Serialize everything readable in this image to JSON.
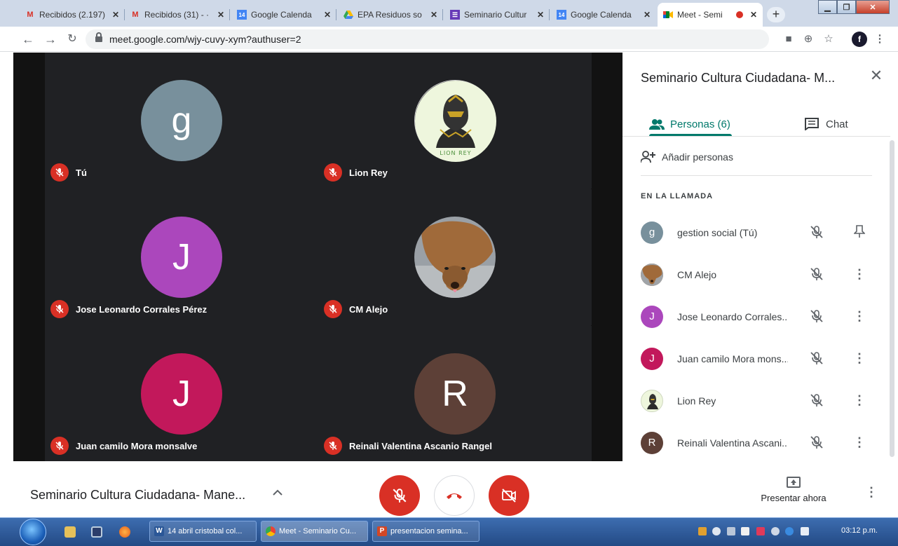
{
  "browser": {
    "tabs": [
      {
        "title": "Recibidos (2.197)",
        "favicon": "gmail-icon"
      },
      {
        "title": "Recibidos (31) - ·",
        "favicon": "gmail-icon"
      },
      {
        "title": "Google Calenda",
        "favicon": "calendar-icon"
      },
      {
        "title": "EPA Residuos so",
        "favicon": "drive-icon"
      },
      {
        "title": "Seminario Cultur",
        "favicon": "forms-icon"
      },
      {
        "title": "Google Calenda",
        "favicon": "calendar-icon"
      },
      {
        "title": "Meet - Semi",
        "favicon": "meet-icon"
      }
    ],
    "calendar_day": "14",
    "url": "meet.google.com/wjy-cuvy-xym?authuser=2",
    "profile_initial": "f",
    "new_tab_label": "+"
  },
  "stage": {
    "tiles": [
      {
        "name": "Tú",
        "initial": "g",
        "color": "#78909c",
        "type": "letter"
      },
      {
        "name": "Lion Rey",
        "initial": "",
        "color": "#e8f5d8",
        "type": "logo",
        "logo_text": "LION REY"
      },
      {
        "name": "Jose Leonardo Corrales Pérez",
        "initial": "J",
        "color": "#ab47bc",
        "type": "letter"
      },
      {
        "name": "CM Alejo",
        "initial": "",
        "color": "#8a6a4a",
        "type": "photo"
      },
      {
        "name": "Juan camilo Mora monsalve",
        "initial": "J",
        "color": "#c2185b",
        "type": "letter"
      },
      {
        "name": "Reinali Valentina Ascanio Rangel",
        "initial": "R",
        "color": "#5d4037",
        "type": "letter"
      }
    ]
  },
  "panel": {
    "title": "Seminario Cultura Ciudadana- M...",
    "tab_people": "Personas (6)",
    "tab_chat": "Chat",
    "add_people": "Añadir personas",
    "section_label": "EN LA LLAMADA",
    "participants": [
      {
        "name": "gestion social (Tú)",
        "initial": "g",
        "color": "#78909c",
        "type": "letter",
        "action": "pin-icon"
      },
      {
        "name": "CM Alejo",
        "initial": "",
        "color": "#8a6a4a",
        "type": "photo",
        "action": "more-icon"
      },
      {
        "name": "Jose Leonardo Corrales...",
        "initial": "J",
        "color": "#ab47bc",
        "type": "letter",
        "action": "more-icon"
      },
      {
        "name": "Juan camilo Mora mons...",
        "initial": "J",
        "color": "#c2185b",
        "type": "letter",
        "action": "more-icon"
      },
      {
        "name": "Lion Rey",
        "initial": "",
        "color": "#e8f5d8",
        "type": "logo",
        "action": "more-icon"
      },
      {
        "name": "Reinali Valentina Ascani...",
        "initial": "R",
        "color": "#5d4037",
        "type": "letter",
        "action": "more-icon"
      }
    ]
  },
  "bottom": {
    "meeting_title": "Seminario Cultura Ciudadana- Mane...",
    "present_label": "Presentar ahora"
  },
  "taskbar": {
    "tasks": [
      {
        "label": "14 abril cristobal col...",
        "icon": "word-icon",
        "letter": "W"
      },
      {
        "label": "Meet - Seminario Cu...",
        "icon": "chrome-icon",
        "letter": ""
      },
      {
        "label": "presentacion semina...",
        "icon": "powerpoint-icon",
        "letter": "P"
      }
    ],
    "clock": "03:12 p.m."
  },
  "colors": {
    "meet_red": "#d93025",
    "meet_teal": "#00796b",
    "stage_bg": "#202124"
  }
}
